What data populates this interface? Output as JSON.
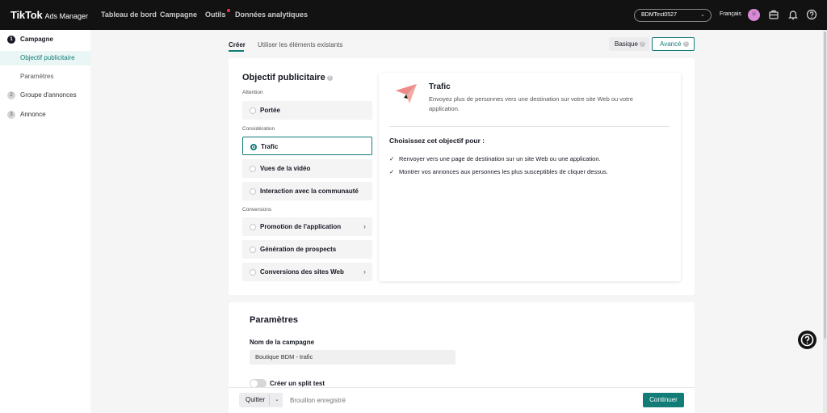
{
  "brand": {
    "name": "TikTok",
    "suffix": "Ads Manager"
  },
  "topnav": [
    {
      "label": "Tableau de bord"
    },
    {
      "label": "Campagne"
    },
    {
      "label": "Outils"
    },
    {
      "label": "Données analytiques"
    }
  ],
  "topbar": {
    "account": "BDMTest0527",
    "language": "Français",
    "avatar_initial": "U",
    "icons": [
      "briefcase-icon",
      "bell-icon",
      "help-icon"
    ]
  },
  "sidebar": {
    "items": [
      {
        "num": "1",
        "label": "Campagne"
      },
      {
        "label": "Objectif publicitaire"
      },
      {
        "label": "Paramètres"
      },
      {
        "num": "2",
        "label": "Groupe d'annonces"
      },
      {
        "num": "3",
        "label": "Annonce"
      }
    ]
  },
  "tabs": [
    {
      "label": "Créer"
    },
    {
      "label": "Utiliser les éléments existants"
    }
  ],
  "modes": {
    "basic": "Basique",
    "advanced": "Avancé"
  },
  "objective": {
    "title": "Objectif publicitaire",
    "groups": [
      {
        "label": "Attention",
        "options": [
          "Portée"
        ]
      },
      {
        "label": "Considération",
        "options": [
          "Trafic",
          "Vues de la vidéo",
          "Interaction avec la communauté"
        ]
      },
      {
        "label": "Conversions",
        "options": [
          "Promotion de l'application",
          "Génération de prospects",
          "Conversions des sites Web"
        ]
      }
    ],
    "selected": "Trafic"
  },
  "detail": {
    "title": "Trafic",
    "description": "Envoyez plus de personnes vers une destination sur votre site Web ou votre application.",
    "choose_heading": "Choisissez cet objectif pour :",
    "bullets": [
      "Renvoyer vers une page de destination sur un site Web ou une application.",
      "Montrer vos annonces aux personnes les plus susceptibles de cliquer dessus."
    ]
  },
  "parameters": {
    "title": "Paramètres",
    "campaign_name_label": "Nom de la campagne",
    "campaign_name_value": "Boutique BDM - trafic",
    "split_test_label": "Créer un split test"
  },
  "footer": {
    "quit": "Quitter",
    "draft": "Brouillon enregistré",
    "continue": "Continuer"
  },
  "colors": {
    "accent": "#127c77",
    "topbar": "#121212",
    "notif_dot": "#fe2c55"
  }
}
